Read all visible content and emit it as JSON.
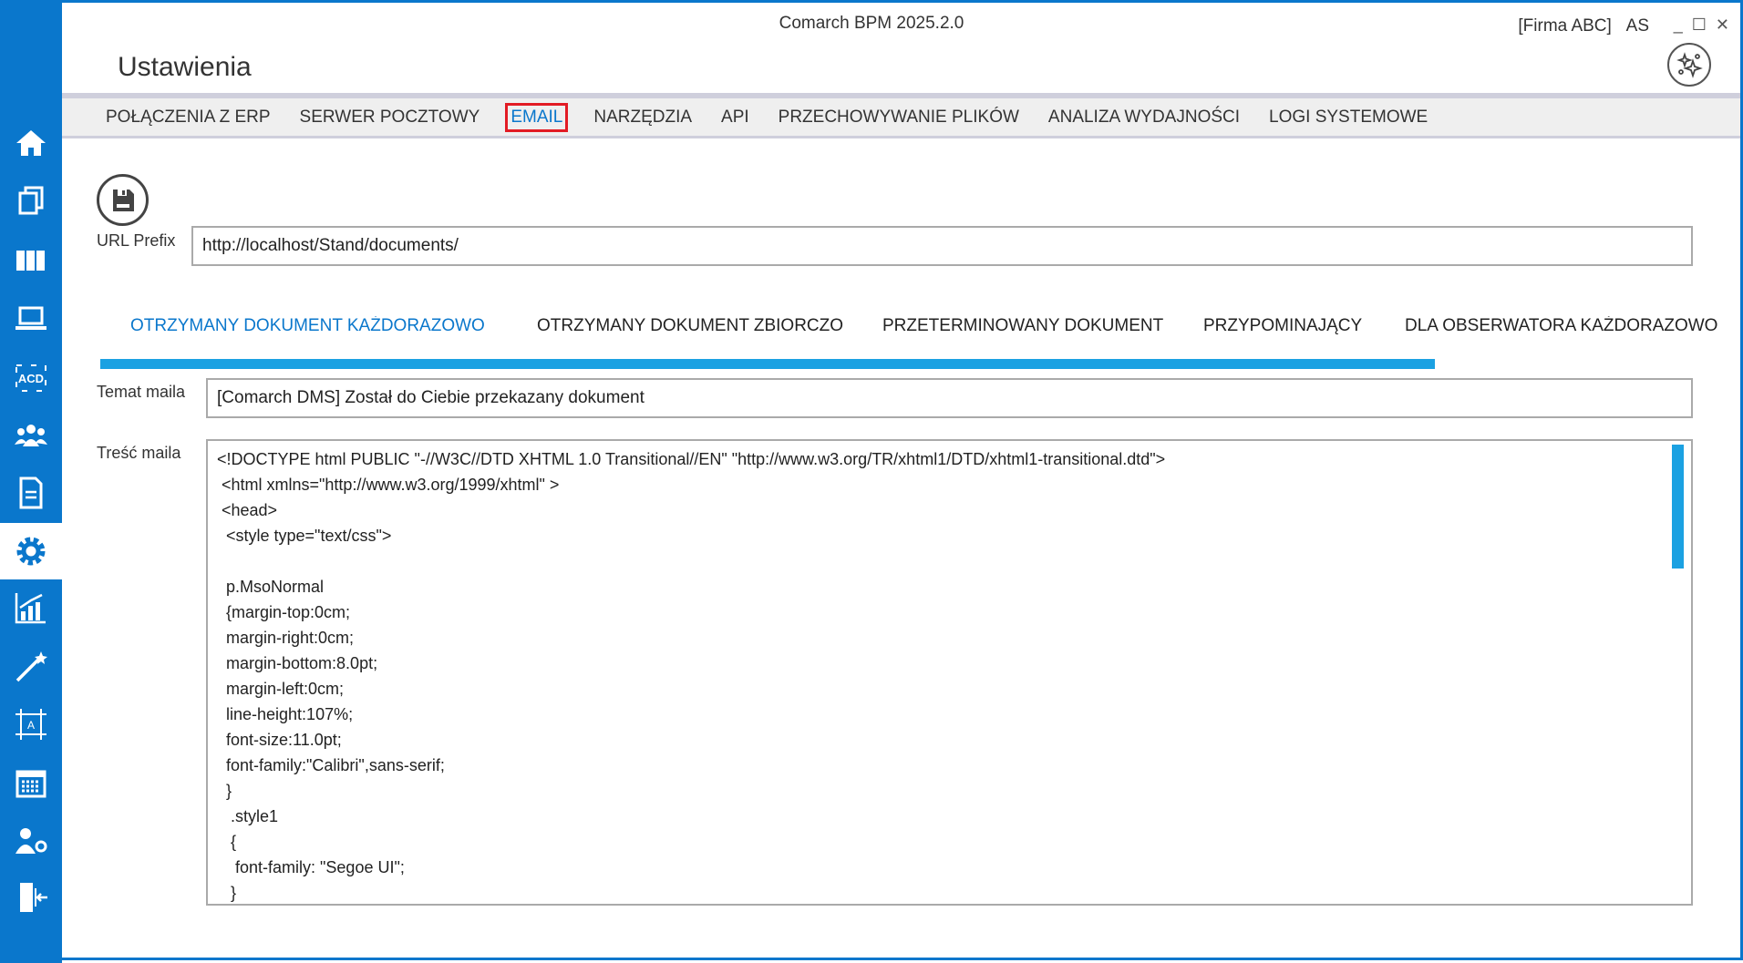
{
  "window": {
    "title": "Comarch BPM 2025.2.0",
    "company": "[Firma ABC]",
    "user": "AS",
    "minimize": "_",
    "maximize": "☐",
    "close": "✕"
  },
  "page_title": "Ustawienia",
  "nav": [
    "POŁĄCZENIA Z ERP",
    "SERWER POCZTOWY",
    "EMAIL",
    "NARZĘDZIA",
    "API",
    "PRZECHOWYWANIE PLIKÓW",
    "ANALIZA WYDAJNOŚCI",
    "LOGI SYSTEMOWE"
  ],
  "active_nav": "EMAIL",
  "url_prefix": {
    "label": "URL Prefix",
    "value": "http://localhost/Stand/documents/"
  },
  "tabs": [
    "OTRZYMANY DOKUMENT KAŻDORAZOWO",
    "OTRZYMANY DOKUMENT ZBIORCZO",
    "PRZETERMINOWANY DOKUMENT",
    "PRZYPOMINAJĄCY",
    "DLA OBSERWATORA KAŻDORAZOWO"
  ],
  "subject": {
    "label": "Temat maila",
    "value": "[Comarch DMS] Został do Ciebie przekazany dokument"
  },
  "body": {
    "label": "Treść maila",
    "lines": [
      "<!DOCTYPE html PUBLIC \"-//W3C//DTD XHTML 1.0 Transitional//EN\" \"http://www.w3.org/TR/xhtml1/DTD/xhtml1-transitional.dtd\">",
      " <html xmlns=\"http://www.w3.org/1999/xhtml\" >",
      " <head>",
      "  <style type=\"text/css\">",
      "",
      "  p.MsoNormal",
      "  {margin-top:0cm;",
      "  margin-right:0cm;",
      "  margin-bottom:8.0pt;",
      "  margin-left:0cm;",
      "  line-height:107%;",
      "  font-size:11.0pt;",
      "  font-family:\"Calibri\",sans-serif;",
      "  }",
      "   .style1",
      "   {",
      "    font-family: \"Segoe UI\";",
      "   }"
    ]
  },
  "sidebar": [
    "home",
    "documents",
    "binders",
    "computer",
    "acd",
    "users",
    "document-sync",
    "settings",
    "analytics",
    "wizard",
    "designer",
    "calendar",
    "user-settings",
    "logout"
  ],
  "colors": {
    "accent": "#0a77cc",
    "tab_bar": "#1ba1e2",
    "highlight": "#e21b24"
  }
}
